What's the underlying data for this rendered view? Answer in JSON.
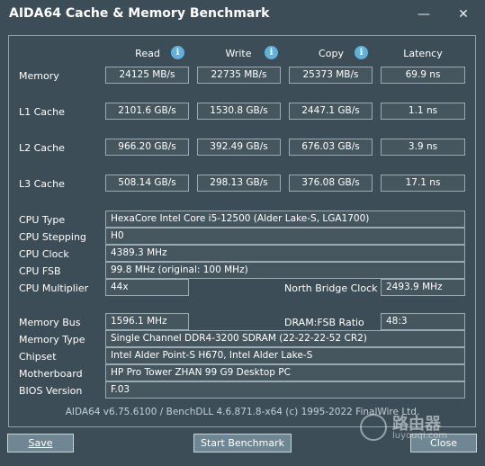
{
  "window": {
    "title": "AIDA64 Cache & Memory Benchmark"
  },
  "titlebar": {
    "minimize": "—",
    "close": "✕"
  },
  "columns": [
    "Read",
    "Write",
    "Copy",
    "Latency"
  ],
  "rows": [
    {
      "label": "Memory",
      "read": "24125 MB/s",
      "write": "22735 MB/s",
      "copy": "25373 MB/s",
      "latency": "69.9 ns"
    },
    {
      "label": "L1 Cache",
      "read": "2101.6 GB/s",
      "write": "1530.8 GB/s",
      "copy": "2447.1 GB/s",
      "latency": "1.1 ns"
    },
    {
      "label": "L2 Cache",
      "read": "966.20 GB/s",
      "write": "392.49 GB/s",
      "copy": "676.03 GB/s",
      "latency": "3.9 ns"
    },
    {
      "label": "L3 Cache",
      "read": "508.14 GB/s",
      "write": "298.13 GB/s",
      "copy": "376.08 GB/s",
      "latency": "17.1 ns"
    }
  ],
  "cpu": {
    "type_label": "CPU Type",
    "type_value": "HexaCore Intel Core i5-12500  (Alder Lake-S, LGA1700)",
    "stepping_label": "CPU Stepping",
    "stepping_value": "H0",
    "clock_label": "CPU Clock",
    "clock_value": "4389.3 MHz",
    "fsb_label": "CPU FSB",
    "fsb_value": "99.8 MHz  (original: 100 MHz)",
    "multiplier_label": "CPU Multiplier",
    "multiplier_value": "44x",
    "nb_clock_label": "North Bridge Clock",
    "nb_clock_value": "2493.9 MHz"
  },
  "system": {
    "membus_label": "Memory Bus",
    "membus_value": "1596.1 MHz",
    "ratio_label": "DRAM:FSB Ratio",
    "ratio_value": "48:3",
    "memtype_label": "Memory Type",
    "memtype_value": "Single Channel DDR4-3200 SDRAM  (22-22-22-52 CR2)",
    "chipset_label": "Chipset",
    "chipset_value": "Intel Alder Point-S H670, Intel Alder Lake-S",
    "mobo_label": "Motherboard",
    "mobo_value": "HP Pro Tower ZHAN 99 G9 Desktop PC",
    "bios_label": "BIOS Version",
    "bios_value": "F.03"
  },
  "footer": "AIDA64 v6.75.6100 / BenchDLL 4.6.871.8-x64  (c) 1995-2022 FinalWire Ltd.",
  "buttons": {
    "save": "Save",
    "start": "Start Benchmark",
    "close": "Close"
  },
  "watermark": {
    "text": "路由器",
    "sub": "luyouqi.com"
  },
  "colors": {
    "background": "#3d4d57",
    "info_icon": "#5fb2dd",
    "button": "#6f8793"
  }
}
